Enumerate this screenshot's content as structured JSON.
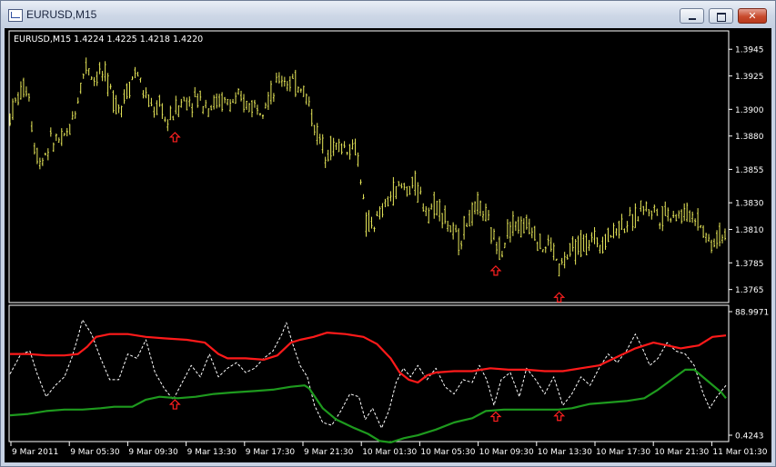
{
  "window": {
    "title": "EURUSD,M15",
    "icon": "chart-window-icon",
    "min_icon": "minimize-icon",
    "max_icon": "maximize-icon",
    "close_label": "✕"
  },
  "colors": {
    "background": "#000000",
    "price_bars": "#e8e85a",
    "upper_band": "#ff1a1a",
    "lower_band": "#1e9a1e",
    "oscillator": "#ffffff",
    "signal_arrow": "#ff2020",
    "axis_text": "#ffffff"
  },
  "chart_data": [
    {
      "type": "bar",
      "panel": "price",
      "title": "EURUSD,M15  1.4224 1.4225 1.4218 1.4220",
      "symbol": "EURUSD",
      "timeframe": "M15",
      "ohlc_readout": [
        "1.4224",
        "1.4225",
        "1.4218",
        "1.4220"
      ],
      "y_ticks": [
        "1.3945",
        "1.3925",
        "1.3900",
        "1.3880",
        "1.3855",
        "1.3830",
        "1.3810",
        "1.3785",
        "1.3765"
      ],
      "ylim": [
        1.376,
        1.3954
      ],
      "price_path": [
        [
          0,
          1.3895
        ],
        [
          6,
          1.3905
        ],
        [
          14,
          1.3915
        ],
        [
          20,
          1.3918
        ],
        [
          26,
          1.3875
        ],
        [
          34,
          1.386
        ],
        [
          42,
          1.3872
        ],
        [
          50,
          1.3878
        ],
        [
          58,
          1.3875
        ],
        [
          66,
          1.3885
        ],
        [
          74,
          1.3905
        ],
        [
          80,
          1.3925
        ],
        [
          86,
          1.3935
        ],
        [
          92,
          1.3922
        ],
        [
          98,
          1.3928
        ],
        [
          104,
          1.3925
        ],
        [
          110,
          1.3915
        ],
        [
          116,
          1.3905
        ],
        [
          122,
          1.3902
        ],
        [
          128,
          1.3912
        ],
        [
          134,
          1.3922
        ],
        [
          140,
          1.393
        ],
        [
          146,
          1.3915
        ],
        [
          152,
          1.3905
        ],
        [
          160,
          1.39
        ],
        [
          168,
          1.3902
        ],
        [
          172,
          1.3888
        ],
        [
          176,
          1.3892
        ],
        [
          182,
          1.39
        ],
        [
          190,
          1.3906
        ],
        [
          200,
          1.3908
        ],
        [
          210,
          1.3908
        ],
        [
          220,
          1.3903
        ],
        [
          230,
          1.3906
        ],
        [
          240,
          1.3905
        ],
        [
          250,
          1.3906
        ],
        [
          260,
          1.3904
        ],
        [
          270,
          1.3903
        ],
        [
          280,
          1.3906
        ],
        [
          286,
          1.391
        ],
        [
          292,
          1.3912
        ],
        [
          298,
          1.3925
        ],
        [
          304,
          1.3922
        ],
        [
          310,
          1.392
        ],
        [
          316,
          1.3918
        ],
        [
          322,
          1.3918
        ],
        [
          328,
          1.3908
        ],
        [
          334,
          1.3892
        ],
        [
          340,
          1.388
        ],
        [
          346,
          1.387
        ],
        [
          352,
          1.3872
        ],
        [
          360,
          1.3872
        ],
        [
          370,
          1.3872
        ],
        [
          380,
          1.3872
        ],
        [
          386,
          1.386
        ],
        [
          392,
          1.3812
        ],
        [
          398,
          1.3815
        ],
        [
          404,
          1.3815
        ],
        [
          410,
          1.3822
        ],
        [
          416,
          1.383
        ],
        [
          422,
          1.3838
        ],
        [
          428,
          1.384
        ],
        [
          434,
          1.3842
        ],
        [
          440,
          1.384
        ],
        [
          446,
          1.3845
        ],
        [
          452,
          1.3835
        ],
        [
          458,
          1.3828
        ],
        [
          464,
          1.3825
        ],
        [
          470,
          1.383
        ],
        [
          476,
          1.3825
        ],
        [
          482,
          1.3815
        ],
        [
          488,
          1.3808
        ],
        [
          494,
          1.38
        ],
        [
          500,
          1.381
        ],
        [
          506,
          1.3818
        ],
        [
          512,
          1.3822
        ],
        [
          518,
          1.3828
        ],
        [
          524,
          1.3822
        ],
        [
          530,
          1.3808
        ],
        [
          536,
          1.38
        ],
        [
          542,
          1.3795
        ],
        [
          548,
          1.3808
        ],
        [
          554,
          1.3815
        ],
        [
          560,
          1.3815
        ],
        [
          566,
          1.381
        ],
        [
          572,
          1.3815
        ],
        [
          578,
          1.3812
        ],
        [
          584,
          1.38
        ],
        [
          590,
          1.3795
        ],
        [
          596,
          1.38
        ],
        [
          602,
          1.379
        ],
        [
          606,
          1.378
        ],
        [
          610,
          1.3785
        ],
        [
          616,
          1.379
        ],
        [
          622,
          1.3795
        ],
        [
          628,
          1.3798
        ],
        [
          636,
          1.38
        ],
        [
          644,
          1.3802
        ],
        [
          652,
          1.3802
        ],
        [
          660,
          1.3805
        ],
        [
          668,
          1.381
        ],
        [
          676,
          1.3815
        ],
        [
          684,
          1.3815
        ],
        [
          690,
          1.3818
        ],
        [
          696,
          1.3828
        ],
        [
          704,
          1.3825
        ],
        [
          710,
          1.3825
        ],
        [
          716,
          1.382
        ],
        [
          724,
          1.3822
        ],
        [
          732,
          1.3823
        ],
        [
          740,
          1.382
        ],
        [
          748,
          1.3822
        ],
        [
          756,
          1.382
        ],
        [
          764,
          1.3812
        ],
        [
          770,
          1.3802
        ],
        [
          776,
          1.38
        ],
        [
          782,
          1.3805
        ],
        [
          790,
          1.3808
        ]
      ],
      "signal_arrows_at": [
        182,
        536,
        606
      ]
    },
    {
      "type": "line",
      "panel": "indicator",
      "y_ticks": [
        "88.9971",
        "0.4243"
      ],
      "ylim": [
        0.4243,
        88.9971
      ],
      "series": [
        {
          "role": "upper-band",
          "points": [
            [
              0,
              58
            ],
            [
              20,
              58
            ],
            [
              40,
              57
            ],
            [
              60,
              57
            ],
            [
              75,
              58
            ],
            [
              85,
              63
            ],
            [
              95,
              70
            ],
            [
              110,
              72
            ],
            [
              130,
              72
            ],
            [
              150,
              70
            ],
            [
              170,
              69
            ],
            [
              195,
              68
            ],
            [
              215,
              66
            ],
            [
              230,
              58
            ],
            [
              240,
              55
            ],
            [
              260,
              55
            ],
            [
              280,
              54
            ],
            [
              295,
              57
            ],
            [
              310,
              66
            ],
            [
              320,
              68
            ],
            [
              335,
              70
            ],
            [
              350,
              73
            ],
            [
              370,
              72
            ],
            [
              390,
              70
            ],
            [
              405,
              65
            ],
            [
              420,
              55
            ],
            [
              430,
              45
            ],
            [
              440,
              40
            ],
            [
              450,
              38
            ],
            [
              460,
              43
            ],
            [
              470,
              45
            ],
            [
              490,
              46
            ],
            [
              510,
              46
            ],
            [
              530,
              48
            ],
            [
              550,
              47
            ],
            [
              570,
              47
            ],
            [
              590,
              46
            ],
            [
              610,
              46
            ],
            [
              630,
              48
            ],
            [
              650,
              50
            ],
            [
              670,
              56
            ],
            [
              690,
              62
            ],
            [
              710,
              66
            ],
            [
              725,
              64
            ],
            [
              740,
              62
            ],
            [
              760,
              64
            ],
            [
              775,
              70
            ],
            [
              790,
              71
            ]
          ]
        },
        {
          "role": "lower-band",
          "points": [
            [
              0,
              15
            ],
            [
              20,
              16
            ],
            [
              40,
              18
            ],
            [
              60,
              19
            ],
            [
              80,
              19
            ],
            [
              100,
              20
            ],
            [
              115,
              21
            ],
            [
              135,
              21
            ],
            [
              150,
              26
            ],
            [
              165,
              28
            ],
            [
              185,
              27
            ],
            [
              205,
              28
            ],
            [
              225,
              30
            ],
            [
              245,
              31
            ],
            [
              270,
              32
            ],
            [
              290,
              33
            ],
            [
              310,
              35
            ],
            [
              325,
              36
            ],
            [
              330,
              34
            ],
            [
              345,
              20
            ],
            [
              360,
              12
            ],
            [
              380,
              6
            ],
            [
              395,
              2
            ],
            [
              408,
              -3
            ],
            [
              420,
              -4
            ],
            [
              435,
              -1
            ],
            [
              450,
              1
            ],
            [
              470,
              5
            ],
            [
              490,
              10
            ],
            [
              510,
              13
            ],
            [
              525,
              18
            ],
            [
              545,
              19
            ],
            [
              565,
              19
            ],
            [
              585,
              19
            ],
            [
              605,
              19
            ],
            [
              620,
              20
            ],
            [
              640,
              23
            ],
            [
              660,
              24
            ],
            [
              680,
              25
            ],
            [
              700,
              27
            ],
            [
              715,
              33
            ],
            [
              730,
              40
            ],
            [
              745,
              47
            ],
            [
              755,
              47
            ],
            [
              770,
              39
            ],
            [
              785,
              31
            ],
            [
              790,
              27
            ]
          ]
        },
        {
          "role": "oscillator",
          "points": [
            [
              0,
              44
            ],
            [
              12,
              58
            ],
            [
              22,
              60
            ],
            [
              30,
              44
            ],
            [
              40,
              28
            ],
            [
              50,
              36
            ],
            [
              60,
              42
            ],
            [
              68,
              55
            ],
            [
              75,
              70
            ],
            [
              80,
              82
            ],
            [
              90,
              72
            ],
            [
              100,
              55
            ],
            [
              110,
              40
            ],
            [
              120,
              40
            ],
            [
              130,
              58
            ],
            [
              140,
              55
            ],
            [
              150,
              68
            ],
            [
              160,
              45
            ],
            [
              170,
              34
            ],
            [
              180,
              26
            ],
            [
              190,
              38
            ],
            [
              200,
              50
            ],
            [
              210,
              42
            ],
            [
              220,
              58
            ],
            [
              230,
              42
            ],
            [
              240,
              48
            ],
            [
              250,
              52
            ],
            [
              260,
              45
            ],
            [
              270,
              48
            ],
            [
              280,
              55
            ],
            [
              290,
              60
            ],
            [
              300,
              72
            ],
            [
              305,
              80
            ],
            [
              312,
              65
            ],
            [
              320,
              50
            ],
            [
              328,
              42
            ],
            [
              336,
              22
            ],
            [
              345,
              10
            ],
            [
              355,
              8
            ],
            [
              365,
              18
            ],
            [
              375,
              30
            ],
            [
              385,
              28
            ],
            [
              392,
              12
            ],
            [
              400,
              20
            ],
            [
              410,
              6
            ],
            [
              418,
              18
            ],
            [
              426,
              38
            ],
            [
              434,
              48
            ],
            [
              442,
              42
            ],
            [
              450,
              50
            ],
            [
              460,
              40
            ],
            [
              470,
              48
            ],
            [
              480,
              35
            ],
            [
              490,
              30
            ],
            [
              500,
              40
            ],
            [
              510,
              38
            ],
            [
              518,
              50
            ],
            [
              526,
              40
            ],
            [
              534,
              22
            ],
            [
              542,
              40
            ],
            [
              552,
              45
            ],
            [
              562,
              28
            ],
            [
              570,
              48
            ],
            [
              580,
              40
            ],
            [
              590,
              30
            ],
            [
              600,
              42
            ],
            [
              610,
              22
            ],
            [
              620,
              30
            ],
            [
              630,
              42
            ],
            [
              640,
              36
            ],
            [
              650,
              48
            ],
            [
              660,
              58
            ],
            [
              670,
              52
            ],
            [
              680,
              60
            ],
            [
              690,
              72
            ],
            [
              698,
              62
            ],
            [
              706,
              50
            ],
            [
              715,
              55
            ],
            [
              725,
              66
            ],
            [
              735,
              60
            ],
            [
              745,
              58
            ],
            [
              755,
              50
            ],
            [
              765,
              30
            ],
            [
              772,
              20
            ],
            [
              780,
              28
            ],
            [
              790,
              36
            ]
          ]
        }
      ],
      "signal_arrows_at": [
        182,
        536,
        606
      ]
    }
  ],
  "time_axis": {
    "labels": [
      "9 Mar 2011",
      "9 Mar 05:30",
      "9 Mar 09:30",
      "9 Mar 13:30",
      "9 Mar 17:30",
      "9 Mar 21:30",
      "10 Mar 01:30",
      "10 Mar 05:30",
      "10 Mar 09:30",
      "10 Mar 13:30",
      "10 Mar 17:30",
      "10 Mar 21:30",
      "11 Mar 01:30"
    ]
  }
}
